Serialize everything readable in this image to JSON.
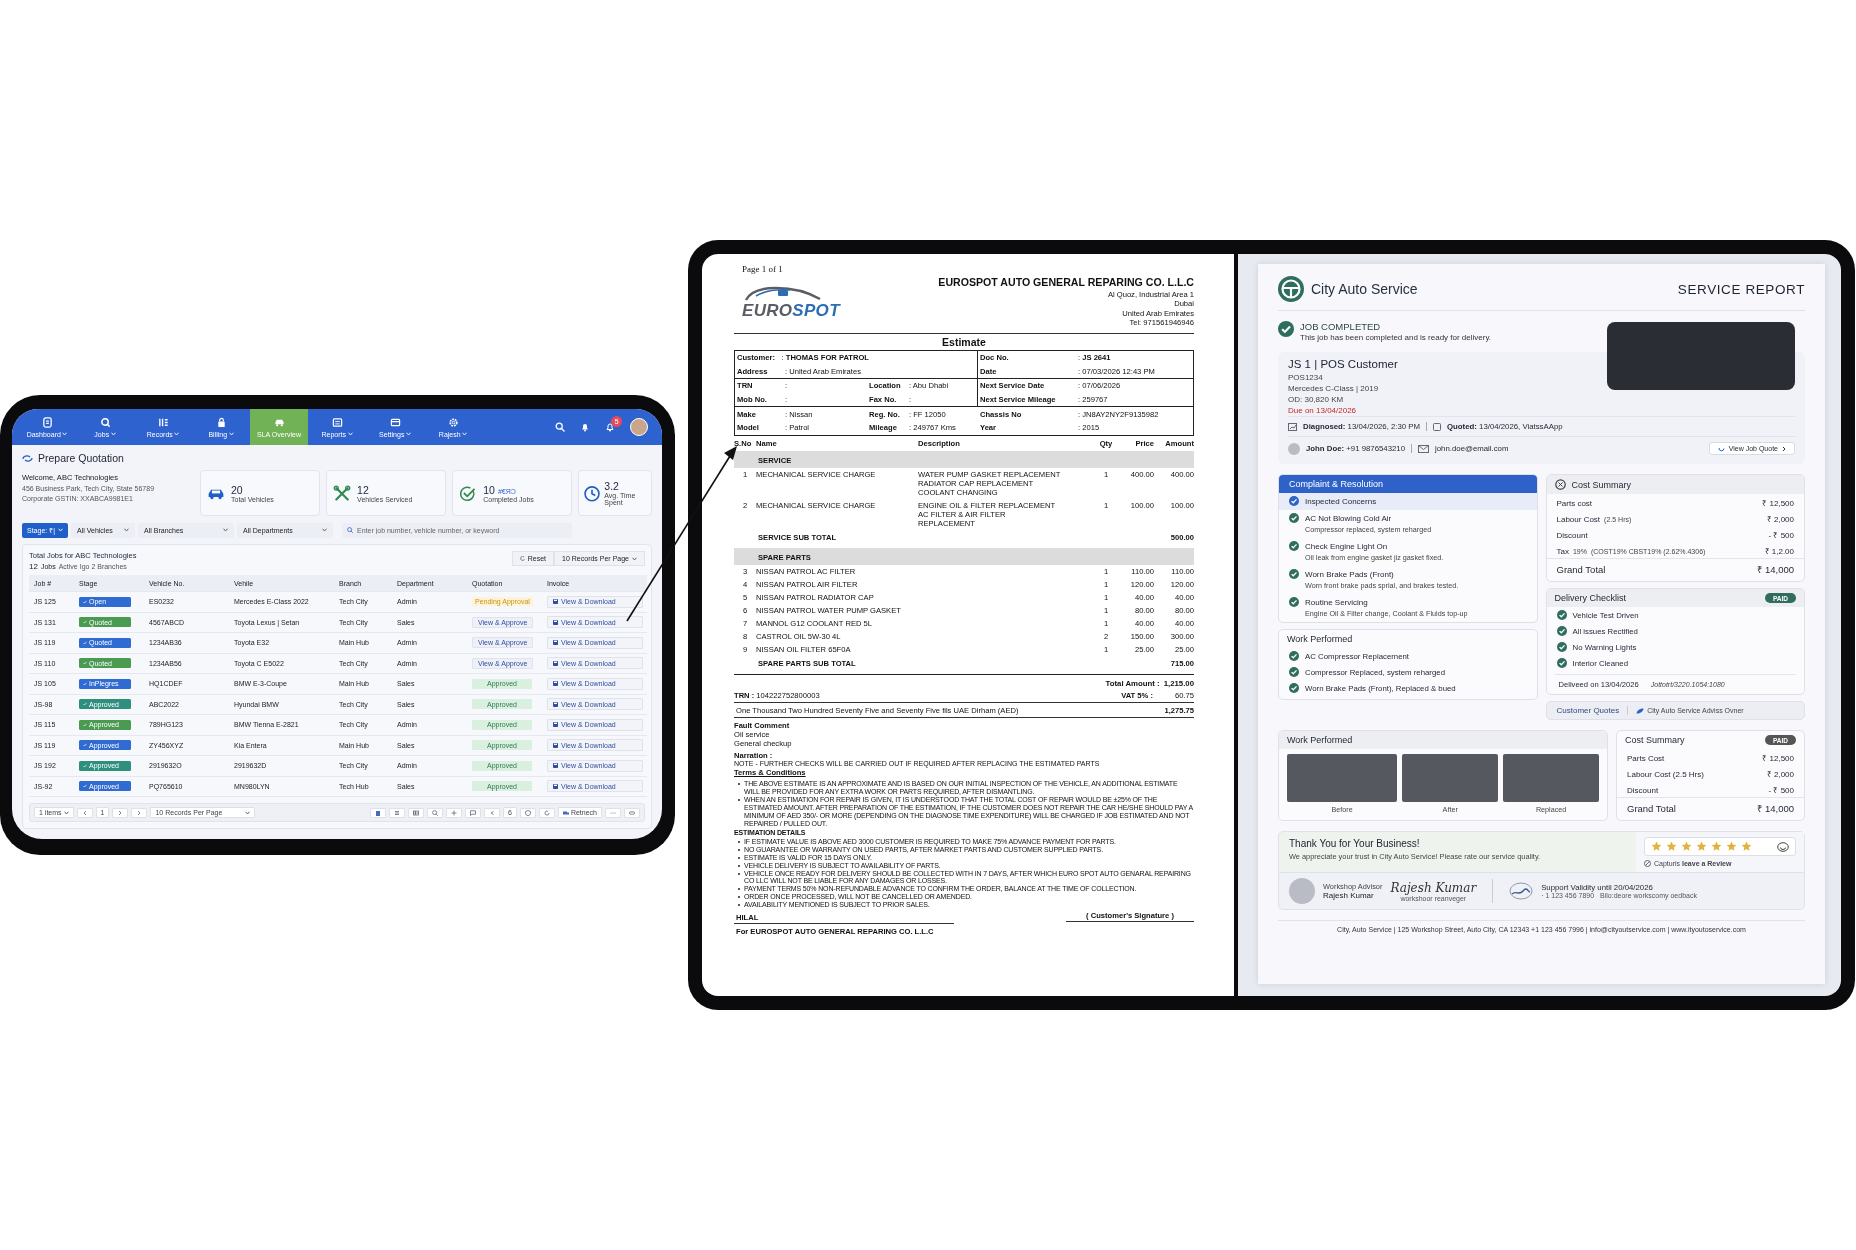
{
  "tablet": {
    "nav": [
      {
        "label": "Dashboard",
        "dropdown": true,
        "selected": false
      },
      {
        "label": "Jobs",
        "dropdown": true,
        "selected": false
      },
      {
        "label": "Records",
        "dropdown": true,
        "selected": false
      },
      {
        "label": "Billing",
        "dropdown": true,
        "selected": false
      },
      {
        "label": "SLA Overview",
        "dropdown": false,
        "selected": true
      },
      {
        "label": "Reports",
        "dropdown": true,
        "selected": false
      },
      {
        "label": "Settings",
        "dropdown": true,
        "selected": false
      },
      {
        "label": "Rajesh",
        "dropdown": true,
        "selected": false
      }
    ],
    "notification_count": "5",
    "page_title": "Prepare Quotation",
    "company": {
      "welcome": "Welcome, ABC Technologies",
      "address": "456 Business Park, Tech City, State 56789",
      "gstin": "Corporate GSTIN: XXABCA9981E1"
    },
    "stats": [
      {
        "value": "20",
        "label": "Total Vehicles"
      },
      {
        "value": "12",
        "label": "Vehicles Serviced"
      },
      {
        "value": "10",
        "note": "#€ЯƆ",
        "label": "Completed Jobs"
      },
      {
        "value": "3.2",
        "label": "Avg. Time Spent"
      }
    ],
    "filters": {
      "stage": "Stage: ₹|",
      "vehicles": "All Vehicles",
      "branches": "All Branches",
      "departments": "All Departments",
      "search_placeholder": "Enter job number, vehicle number, or keyword"
    },
    "jobs": {
      "title": "Total Jobs for ABC Technologies",
      "count": "12",
      "count_unit": "Jobs",
      "count_note": "Active Igo 2 Branches",
      "reset": "Reset",
      "per_page": "10 Records Per Page",
      "columns": [
        "Job #",
        "Stage",
        "Vehicle No.",
        "Vehile",
        "Branch",
        "Department",
        "Quotation",
        "Invoice"
      ],
      "rows": [
        {
          "job": "JS 125",
          "stage": {
            "label": "Open",
            "color": "#2f6bd1"
          },
          "vehicle_no": "ES0232",
          "vehicle": "Mercedes E-Class 2022",
          "branch": "Tech City",
          "department": "Admin",
          "quotation": {
            "kind": "pending",
            "label": "Pending Approval"
          },
          "invoice": "View & Download"
        },
        {
          "job": "JS 131",
          "stage": {
            "label": "Quoted",
            "color": "#4a9a52"
          },
          "vehicle_no": "4567ABCD",
          "vehicle": "Toyota Lexus | Setan",
          "branch": "Tech City",
          "department": "Sales",
          "quotation": {
            "kind": "action",
            "label": "View & Approve"
          },
          "invoice": "View & Download"
        },
        {
          "job": "JS 119",
          "stage": {
            "label": "Quoted",
            "color": "#2f6bd1"
          },
          "vehicle_no": "1234AB36",
          "vehicle": "Toyota E32",
          "branch": "Main Hub",
          "department": "Admin",
          "quotation": {
            "kind": "action",
            "label": "View & Approve"
          },
          "invoice": "View & Download"
        },
        {
          "job": "JS 110",
          "stage": {
            "label": "Quoted",
            "color": "#4a9a52"
          },
          "vehicle_no": "1234AB56",
          "vehicle": "Toyota C E5022",
          "branch": "Tech City",
          "department": "Admin",
          "quotation": {
            "kind": "action",
            "label": "View & Approve"
          },
          "invoice": "View & Download"
        },
        {
          "job": "JS 105",
          "stage": {
            "label": "InPlegres",
            "color": "#2f6bd1"
          },
          "vehicle_no": "HQ1CDEF",
          "vehicle": "BMW E-3-Coupe",
          "branch": "Main Hub",
          "department": "Sales",
          "quotation": {
            "kind": "approved",
            "label": "Approved"
          },
          "invoice": "View & Download"
        },
        {
          "job": "JS-98",
          "stage": {
            "label": "Approved",
            "color": "#2f8f7f"
          },
          "vehicle_no": "ABC2022",
          "vehicle": "Hyundai BMW",
          "branch": "Tech City",
          "department": "Sales",
          "quotation": {
            "kind": "approved",
            "label": "Approved"
          },
          "invoice": "View & Download"
        },
        {
          "job": "JS 115",
          "stage": {
            "label": "Approved",
            "color": "#4a9a52"
          },
          "vehicle_no": "789HG123",
          "vehicle": "BMW Tienna E-2821",
          "branch": "Tech City",
          "department": "Admin",
          "quotation": {
            "kind": "approved",
            "label": "Approved"
          },
          "invoice": "View & Download"
        },
        {
          "job": "JS 119",
          "stage": {
            "label": "Approved",
            "color": "#2f6bd1"
          },
          "vehicle_no": "ZY456XYZ",
          "vehicle": "Kia Entera",
          "branch": "Main Hub",
          "department": "Sales",
          "quotation": {
            "kind": "approved",
            "label": "Approved"
          },
          "invoice": "View & Download"
        },
        {
          "job": "JS 192",
          "stage": {
            "label": "Approved",
            "color": "#2f8f7f"
          },
          "vehicle_no": "2919632O",
          "vehicle": "2919632D",
          "branch": "Tech City",
          "department": "Admin",
          "quotation": {
            "kind": "approved",
            "label": "Approved"
          },
          "invoice": "View & Download"
        },
        {
          "job": "JS-92",
          "stage": {
            "label": "Approved",
            "color": "#2f6bd1"
          },
          "vehicle_no": "PQ765610",
          "vehicle": "MN980LYN",
          "branch": "Tech Hub",
          "department": "Sales",
          "quotation": {
            "kind": "approved",
            "label": "Approved"
          },
          "invoice": "View & Download"
        }
      ]
    },
    "footer": {
      "items": "1 items",
      "page": "1",
      "per_page": "10 Records Per Page",
      "count": "6",
      "refresh": "Retnech"
    }
  },
  "estimate": {
    "page": "Page 1 of 1",
    "logo": [
      "EURO",
      "SPOT"
    ],
    "company": "EUROSPOT AUTO GENERAL REPARING CO. L.L.C",
    "address": [
      "Al Quoz, Industrial Area 1",
      "Dubai",
      "United Arab Emirates",
      "Tel: 971561946946"
    ],
    "title": "Estimate",
    "info": [
      {
        "divided": true,
        "rows": [
          {
            "left": [
              {
                "label": "Customer:",
                "value": ": **THOMAS FOR PATROL**"
              }
            ],
            "right": {
              "label": "Doc No.",
              "value": ": **JS 2641**"
            }
          },
          {
            "left": [
              {
                "label": "Address",
                "value": ": United Arab Emirates"
              }
            ],
            "right": {
              "label": "Date",
              "value": ": 07/03/2026 12:43 PM"
            }
          }
        ]
      },
      {
        "divided": true,
        "rows": [
          {
            "left": [
              {
                "label": "TRN",
                "value": ":"
              },
              {
                "label": "Location",
                "value": ": Abu Dhabi"
              }
            ],
            "right": {
              "label": "Next Service Date",
              "value": ": 07/06/2026"
            }
          },
          {
            "left": [
              {
                "label": "Mob No.",
                "value": ":"
              },
              {
                "label": "Fax No.",
                "value": ":"
              }
            ],
            "right": {
              "label": "Next Service Mileage",
              "value": ": 259767"
            }
          }
        ]
      },
      {
        "divided": false,
        "rows": [
          {
            "left": [
              {
                "label": "Make",
                "value": ": Nissan"
              },
              {
                "label": "Reg. No.",
                "value": ": FF 12050"
              }
            ],
            "right": {
              "label": "Chassis No",
              "value": ": JN8AY2NY2F9135982"
            }
          },
          {
            "left": [
              {
                "label": "Model",
                "value": ": Patrol"
              },
              {
                "label": "Mileage",
                "value": ": 249767 Kms"
              }
            ],
            "right": {
              "label": "Year",
              "value": ": 2015"
            }
          }
        ]
      }
    ],
    "columns": [
      "S.No",
      "Name",
      "Description",
      "Qty",
      "Price",
      "Amount"
    ],
    "sections": [
      {
        "title": "SERVICE",
        "items": [
          {
            "no": "1",
            "name": "MECHANICAL SERVICE CHARGE",
            "description": [
              "WATER PUMP GASKET REPLACEMENT",
              "RADIATOR CAP REPLACEMENT",
              "COOLANT CHANGING"
            ],
            "qty": "1",
            "price": "400.00",
            "amount": "400.00"
          },
          {
            "no": "2",
            "name": "MECHANICAL SERVICE CHARGE",
            "description": [
              "ENGINE OIL & FILTER REPLACEMENT",
              "AC FILTER & AIR FILTER",
              "REPLACEMENT"
            ],
            "qty": "1",
            "price": "100.00",
            "amount": "100.00"
          }
        ],
        "subtotal_label": "SERVICE SUB TOTAL",
        "subtotal": "500.00"
      },
      {
        "title": "SPARE PARTS",
        "items": [
          {
            "no": "3",
            "name": "NISSAN PATROL AC FILTER",
            "qty": "1",
            "price": "110.00",
            "amount": "110.00"
          },
          {
            "no": "4",
            "name": "NISSAN PATROL AIR FILTER",
            "qty": "1",
            "price": "120.00",
            "amount": "120.00"
          },
          {
            "no": "5",
            "name": "NISSAN PATROL RADIATOR CAP",
            "qty": "1",
            "price": "40.00",
            "amount": "40.00"
          },
          {
            "no": "6",
            "name": "NISSAN PATROL WATER PUMP GASKET",
            "qty": "1",
            "price": "80.00",
            "amount": "80.00"
          },
          {
            "no": "7",
            "name": "MANNOL G12 COOLANT RED 5L",
            "qty": "1",
            "price": "40.00",
            "amount": "40.00"
          },
          {
            "no": "8",
            "name": "CASTROL OIL 5W-30 4L",
            "qty": "2",
            "price": "150.00",
            "amount": "300.00"
          },
          {
            "no": "9",
            "name": "NISSAN OIL FILTER 65F0A",
            "qty": "1",
            "price": "25.00",
            "amount": "25.00"
          }
        ],
        "subtotal_label": "SPARE PARTS SUB TOTAL",
        "subtotal": "715.00"
      }
    ],
    "total_label": "Total Amount :",
    "total": "1,215.00",
    "trn": "**TRN :** 104222752800003",
    "vat_label": "VAT 5% :",
    "vat": "60.75",
    "words": "One Thousand Two Hundred Seventy Five and Seventy Five fils UAE Dirham (AED)",
    "grand_total": "1,275.75",
    "fault_title": "Fault Comment",
    "fault_lines": [
      "Oil service",
      "General checkup"
    ],
    "narration_title": "Narration :",
    "narration": "NOTE - FURTHER CHECKS WILL BE CARRIED OUT IF REQUIRED AFTER REPLACING THE ESTIMATED PARTS",
    "terms_title": "Terms & Conditions",
    "terms": [
      "THE ABOVE ESTIMATE IS AN APPROXIMATE AND IS BASED ON OUR INITIAL INSPECTION OF THE VEHICLE, AN ADDITIONAL ESTIMATE WILL BE PROVIDED FOR ANY EXTRA WORK OR PARTS REQUIRED, AFTER DISMANTLING.",
      "WHEN AN ESTIMATION FOR REPAIR IS GIVEN, IT IS UNDERSTOOD THAT THE TOTAL COST OF REPAIR WOULD BE ±25% OF THE ESTIMATED AMOUNT. AFTER PREPARATION OF THE ESTIMATION, IF THE CUSTOMER DOES NOT REPAIR THE CAR HE/SHE SHOULD PAY A MINIMUM OF AED 350/- OR MORE (DEPENDING ON THE DIAGNOSE TIME EXPENDITURE) WILL BE CHARGED IF JOB ESTIMATED AND NOT REPAIRED / PULLED OUT."
    ],
    "details_title": "ESTIMATION DETAILS",
    "details": [
      "IF ESTIMATE VALUE IS ABOVE AED 3000 CUSTOMER IS REQUIRED TO MAKE 75% ADVANCE PAYMENT FOR PARTS.",
      "NO GUARANTEE OR WARRANTY ON USED PARTS, AFTER MARKET PARTS AND CUSTOMER SUPPLIED PARTS.",
      "ESTIMATE IS VALID FOR 15 DAYS ONLY.",
      "VEHICLE DELIVERY IS SUBJECT TO AVAILABILITY OF PARTS.",
      "VEHICLE ONCE READY FOR DELIVERY SHOULD BE COLLECTED WITH IN 7 DAYS, AFTER WHICH EURO SPOT AUTO GENARAL REPAIRING CO LLC WILL NOT BE LIABLE FOR ANY DAMAGES OR LOSSES.",
      "PAYMENT TERMS 50% NON-REFUNDABLE ADVANCE TO CONFIRM THE ORDER, BALANCE AT THE TIME OF COLLECTION.",
      "ORDER ONCE PROCESSED, WILL NOT BE CANCELLED OR AMENDED.",
      "AVAILABILITY MENTIONED IS SUBJECT TO PRIOR SALES."
    ],
    "customer_signature": "( Customer's Signature )",
    "signer": "HILAL",
    "signer_company": "For EUROSPOT AUTO GENERAL REPARING CO. L.L.C"
  },
  "report": {
    "brand": "City Auto Service",
    "title": "SERVICE REPORT",
    "status": {
      "title": "JOB COMPLETED",
      "message": "This job has been completed and is ready for delivery."
    },
    "job": {
      "heading": "JS 1 | POS Customer",
      "plate": "POS1234",
      "model": "Mercedes C-Class | 2019",
      "odometer": "OD: 30,820 KM",
      "due": "Due on 13/04/2026",
      "diagnosed": "**Diagnosed:** 13/04/2026, 2:30 PM",
      "quoted": "**Quoted:** 13/04/2026, ViatssAApp",
      "contact": "**John Doe:** +91 9876543210",
      "email": "john.doe@email.com",
      "quote_button": "View Job Quote"
    },
    "complaints": {
      "title": "Complaint & Resolution",
      "items": [
        {
          "title": "Inspected Concerns",
          "highlighted": true
        },
        {
          "title": "AC Not Blowing Cold Air",
          "detail": "Compressor replaced, system reharged",
          "highlighted": false
        },
        {
          "title": "Check Engine Light On",
          "detail": "Oil leak from engine gasket jiz gasket fixed.",
          "highlighted": false
        },
        {
          "title": "Worn Brake Pads (Front)",
          "detail": "Worn front brake pads sprial, and brakes tested.",
          "highlighted": false
        },
        {
          "title": "Routine Servicing",
          "detail": "Engine Oil & Filter change,  Coolant & Fluids top-up",
          "highlighted": false
        }
      ]
    },
    "work": {
      "title": "Work Performed",
      "items": [
        "AC Compressor Replacernent",
        "Compressor Replaced, system reharged",
        "Worn Brake Pads (Front), Replaced & bued"
      ]
    },
    "cost": {
      "title": "Cost Summary",
      "lines": [
        {
          "kind": "line",
          "label": "Parts cost",
          "value": "₹ 12,500"
        },
        {
          "kind": "line",
          "label": "Labour Cost",
          "note": "(2.5 Hrs)",
          "value": "₹ 2,000"
        },
        {
          "kind": "line",
          "label": "Discount",
          "value": "- ₹ 500"
        },
        {
          "kind": "line",
          "label": "Tax",
          "note": "19%",
          "detail": "(COST19% CBST19% (2.62%.4306)",
          "value": "₹ 1,2.00"
        },
        {
          "kind": "total",
          "label": "Grand Total",
          "value": "₹ 14,000"
        }
      ]
    },
    "checklist": {
      "title": "Delivery Checklist",
      "badge": "PAID",
      "items": [
        "Vehicle Test Driven",
        "All issues Rectified",
        "No Warning Lights",
        "Interior Cleaned"
      ],
      "delivered": "Deliveed on 13/04/2026",
      "reference": "Jottotrt/3220.1054:1080"
    },
    "quotes": {
      "label": "Customer Quotes",
      "owner": "City Auto Service Adviss Ovner"
    },
    "photos": {
      "title": "Work Performed",
      "captions": [
        "Before",
        "After",
        "Replaced"
      ]
    },
    "cost_paid": {
      "title": "Cost Summary",
      "badge": "PAID",
      "lines": [
        {
          "kind": "line",
          "label": "Parts Cost",
          "value": "₹ 12,500"
        },
        {
          "kind": "line",
          "label": "Labour Cost (2.5 Hrs)",
          "value": "₹ 2,000"
        },
        {
          "kind": "line",
          "label": "Discount",
          "value": "- ₹ 500"
        },
        {
          "kind": "total",
          "label": "Grand Total",
          "value": "₹ 14,000"
        }
      ]
    },
    "thanks": {
      "title": "Thank You for Your Business!",
      "message": "We appreciate your trust in City Auto Service! Please rate our service quality.",
      "stars": 7,
      "review": "Capturis **leave a Review**"
    },
    "advisor": {
      "role": "Workshop Advisor",
      "name": "Rajesh Kumar",
      "signature": "Rajesh Kumar",
      "signature_caption": "workshoor reanveger"
    },
    "support": {
      "title": "Support Validity until 20/04/2026",
      "phone": "· 1 123 456 7890",
      "link": "Bilo:deore workscomy oedback"
    },
    "footer": "City, Auto Service  |  125 Workshop Street, Auto City, CA 12343  +1 123 456 7996  |  info@cityoutservice.com  |  www.ityoutoservice.com"
  }
}
